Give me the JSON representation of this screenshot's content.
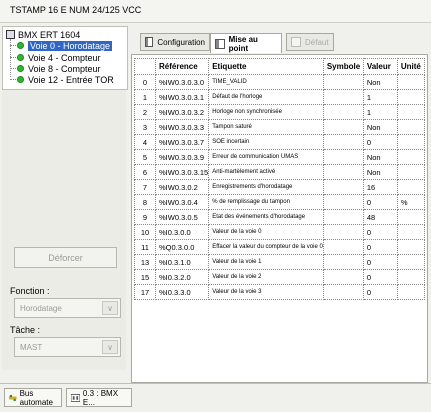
{
  "title": "TSTAMP 16 E NUM 24/125 VCC",
  "tree": {
    "root": "BMX ERT 1604",
    "items": [
      {
        "label": "Voie 0 - Horodatage",
        "selected": true
      },
      {
        "label": "Voie 4 - Compteur",
        "selected": false
      },
      {
        "label": "Voie 8 - Compteur",
        "selected": false
      },
      {
        "label": "Voie 12 - Entrée TOR",
        "selected": false
      }
    ]
  },
  "left": {
    "deforcer": "Déforcer",
    "fonction_label": "Fonction :",
    "fonction_value": "Horodatage",
    "tache_label": "Tâche :",
    "tache_value": "MAST"
  },
  "tabs": [
    {
      "label": "Configuration"
    },
    {
      "label": "Mise au point"
    },
    {
      "label": "Défaut"
    }
  ],
  "grid": {
    "columns": [
      "",
      "Référence",
      "Etiquette",
      "Symbole",
      "Valeur",
      "Unité"
    ],
    "rows": [
      [
        "0",
        "%IW0.3.0.3.0",
        "TIME_VALID",
        "",
        "Non",
        ""
      ],
      [
        "1",
        "%IW0.3.0.3.1",
        "Défaut de l'horloge",
        "",
        "1",
        ""
      ],
      [
        "2",
        "%IW0.3.0.3.2",
        "Horloge non synchronisée",
        "",
        "1",
        ""
      ],
      [
        "3",
        "%IW0.3.0.3.3",
        "Tampon saturé",
        "",
        "Non",
        ""
      ],
      [
        "4",
        "%IW0.3.0.3.7",
        "SOE incertain",
        "",
        "0",
        ""
      ],
      [
        "5",
        "%IW0.3.0.3.9",
        "Erreur de communication UMAS",
        "",
        "Non",
        ""
      ],
      [
        "6",
        "%IW0.3.0.3.15",
        "Anti-martèlement activé",
        "",
        "Non",
        ""
      ],
      [
        "7",
        "%IW0.3.0.2",
        "Enregistrements d'horodatage",
        "",
        "16",
        ""
      ],
      [
        "8",
        "%IW0.3.0.4",
        "% de remplissage du tampon",
        "",
        "0",
        "%"
      ],
      [
        "9",
        "%IW0.3.0.5",
        "Etat des événements d'horodatage",
        "",
        "48",
        ""
      ],
      [
        "10",
        "%I0.3.0.0",
        "Valeur de la voie 0",
        "",
        "0",
        ""
      ],
      [
        "11",
        "%Q0.3.0.0",
        "Effacer la valeur du compteur de la voie 0",
        "",
        "0",
        ""
      ],
      [
        "13",
        "%I0.3.1.0",
        "Valeur de la voie 1",
        "",
        "0",
        ""
      ],
      [
        "15",
        "%I0.3.2.0",
        "Valeur de la voie 2",
        "",
        "0",
        ""
      ],
      [
        "17",
        "%I0.3.3.0",
        "Valeur de la voie 3",
        "",
        "0",
        ""
      ]
    ]
  },
  "statusbar": {
    "tabs": [
      {
        "label": "Bus automate"
      },
      {
        "label": "0.3 : BMX E..."
      }
    ]
  }
}
